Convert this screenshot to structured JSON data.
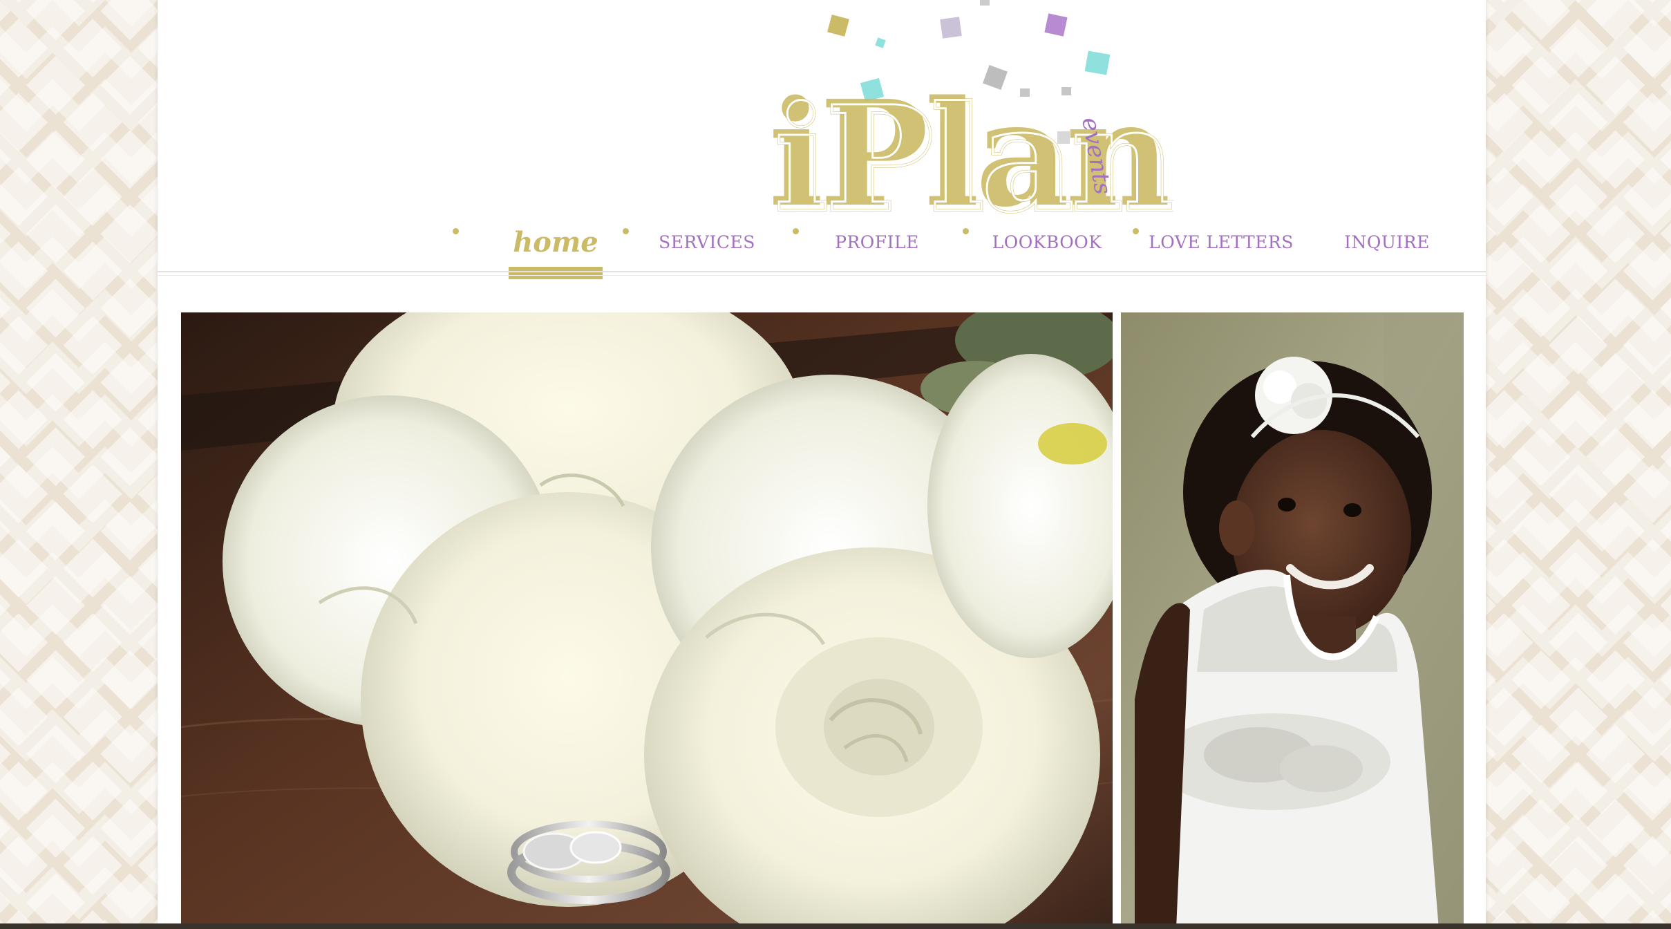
{
  "brand": {
    "wordmark": "iPlan",
    "tagline": "events",
    "gold": "#cbbb66",
    "purple": "#a36fc0"
  },
  "nav": {
    "items": [
      {
        "label": "home",
        "active": true
      },
      {
        "label": "SERVICES",
        "active": false
      },
      {
        "label": "PROFILE",
        "active": false
      },
      {
        "label": "LOOKBOOK",
        "active": false
      },
      {
        "label": "LOVE LETTERS",
        "active": false
      },
      {
        "label": "INQUIRE",
        "active": false
      }
    ],
    "separator_icon": "dot-icon"
  },
  "gallery": {
    "images": [
      {
        "subject": "white-roses-and-wedding-rings-photo"
      },
      {
        "subject": "flower-girl-in-white-dress-photo"
      }
    ]
  }
}
